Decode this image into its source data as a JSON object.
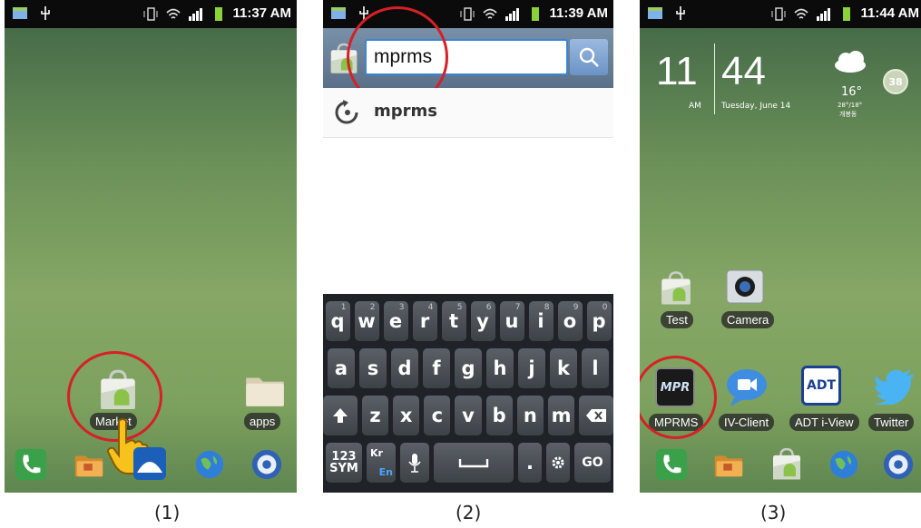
{
  "panels": [
    {
      "caption": "(1)",
      "status_time": "11:37 AM",
      "home_icons": [
        {
          "label": "Market",
          "icon": "market-bag-icon"
        },
        {
          "label": "apps",
          "icon": "folder-icon"
        }
      ],
      "dock": [
        "phone-icon",
        "folder-icon",
        "tmap-icon",
        "globe-icon",
        "settings-gear-icon"
      ]
    },
    {
      "caption": "(2)",
      "status_time": "11:39 AM",
      "search_value": "mprms",
      "suggestion": "mprms",
      "keyboard": {
        "row1": [
          {
            "key": "q",
            "num": "1"
          },
          {
            "key": "w",
            "num": "2"
          },
          {
            "key": "e",
            "num": "3"
          },
          {
            "key": "r",
            "num": "4"
          },
          {
            "key": "t",
            "num": "5"
          },
          {
            "key": "y",
            "num": "6"
          },
          {
            "key": "u",
            "num": "7"
          },
          {
            "key": "i",
            "num": "8"
          },
          {
            "key": "o",
            "num": "9"
          },
          {
            "key": "p",
            "num": "0"
          }
        ],
        "row2": [
          "a",
          "s",
          "d",
          "f",
          "g",
          "h",
          "j",
          "k",
          "l"
        ],
        "row3": [
          "z",
          "x",
          "c",
          "v",
          "b",
          "n",
          "m"
        ],
        "sym_key_line1": "123",
        "sym_key_line2": "SYM",
        "lang_key_kr": "Kr",
        "lang_key_en": "En",
        "period_key": ".",
        "go_key": "GO"
      }
    },
    {
      "caption": "(3)",
      "status_time": "11:44 AM",
      "clock_hour": "11",
      "clock_minute": "44",
      "clock_ampm": "AM",
      "clock_date": "Tuesday, June 14",
      "weather_temp": "16°",
      "weather_range": "28°/18°",
      "weather_location": "개봉동",
      "badge_number": "38",
      "home_icons": [
        {
          "label": "Test",
          "icon": "market-test-icon"
        },
        {
          "label": "Camera",
          "icon": "camera-icon"
        },
        {
          "label": "MPRMS",
          "icon": "mprms-icon",
          "icon_text": "MPR"
        },
        {
          "label": "IV-Client",
          "icon": "iv-client-icon"
        },
        {
          "label": "ADT i-View",
          "icon": "adt-icon",
          "icon_text": "ADT"
        },
        {
          "label": "Twitter",
          "icon": "twitter-bird-icon"
        }
      ],
      "dock": [
        "phone-icon",
        "folder-icon",
        "market-bag-icon",
        "globe-icon",
        "settings-gear-icon"
      ]
    }
  ],
  "colors": {
    "highlight_circle": "#d62026",
    "status_bar": "#0b0b0b",
    "search_bar": "#5d7690"
  }
}
